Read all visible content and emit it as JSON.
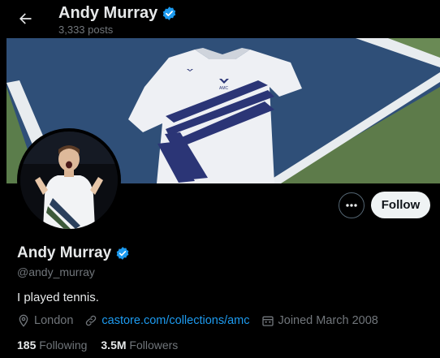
{
  "header": {
    "name": "Andy Murray",
    "posts": "3,333 posts"
  },
  "banner": {
    "shirt_logo": "AMC"
  },
  "profile": {
    "display_name": "Andy Murray",
    "handle": "@andy_murray",
    "bio": "I played tennis.",
    "location": "London",
    "website": "castore.com/collections/amc",
    "joined": "Joined March 2008",
    "following_count": "185",
    "following_label": "Following",
    "followers_count": "3.5M",
    "followers_label": "Followers"
  },
  "actions": {
    "follow_label": "Follow",
    "more_icon": "more-dots-icon"
  },
  "colors": {
    "accent": "#1d9bf0",
    "background": "#000000",
    "secondary_text": "#71767b",
    "court_blue": "#2b4b73",
    "court_green": "#5b7a4a"
  }
}
